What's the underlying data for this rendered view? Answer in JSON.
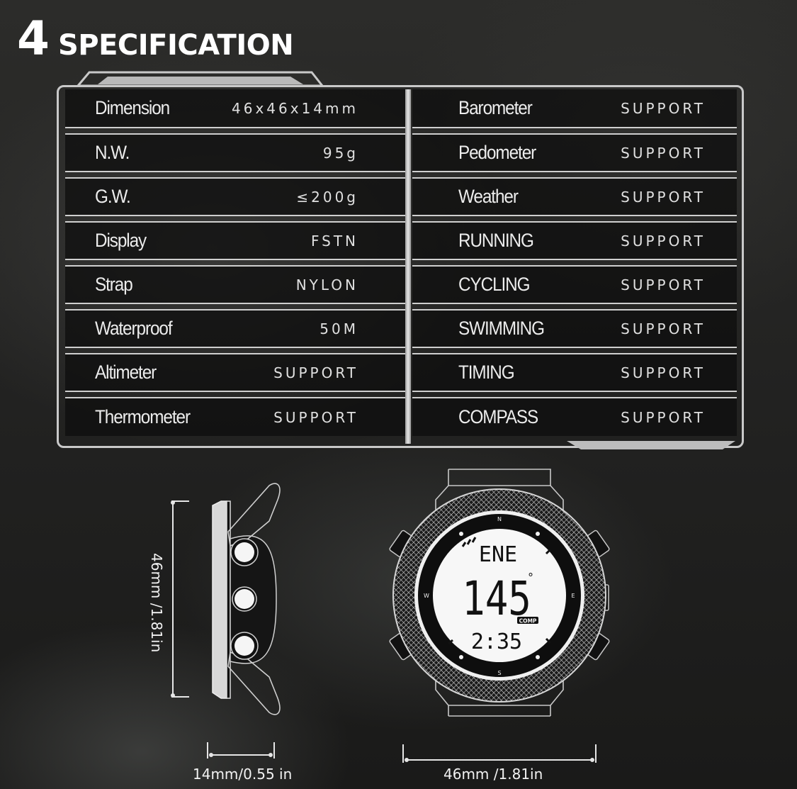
{
  "header": {
    "section_number": "4",
    "title": "SPECIFICATION"
  },
  "specs_left": [
    {
      "label": "Dimension",
      "value": "46x46x14mm"
    },
    {
      "label": "N.W.",
      "value": "95g"
    },
    {
      "label": "G.W.",
      "value": "≤200g"
    },
    {
      "label": "Display",
      "value": "FSTN"
    },
    {
      "label": "Strap",
      "value": "NYLON"
    },
    {
      "label": "Waterproof",
      "value": "50M"
    },
    {
      "label": "Altimeter",
      "value": "SUPPORT"
    },
    {
      "label": "Thermometer",
      "value": "SUPPORT"
    }
  ],
  "specs_right": [
    {
      "label": "Barometer",
      "value": "SUPPORT"
    },
    {
      "label": "Pedometer",
      "value": "SUPPORT"
    },
    {
      "label": "Weather",
      "value": "SUPPORT"
    },
    {
      "label": "RUNNING",
      "value": "SUPPORT"
    },
    {
      "label": "CYCLING",
      "value": "SUPPORT"
    },
    {
      "label": "SWIMMING",
      "value": "SUPPORT"
    },
    {
      "label": "TIMING",
      "value": "SUPPORT"
    },
    {
      "label": "COMPASS",
      "value": "SUPPORT"
    }
  ],
  "side_view": {
    "height_label": "46mm /1.81in",
    "thickness_label": "14mm/0.55 in"
  },
  "front_view": {
    "width_label": "46mm /1.81in",
    "display": {
      "direction": "ENE",
      "bearing": "145",
      "degree_symbol": "°",
      "mode_badge": "COMP",
      "time": "2:35"
    },
    "bezel_marks": {
      "north": "N",
      "east": "E",
      "south": "S",
      "west": "W"
    }
  }
}
